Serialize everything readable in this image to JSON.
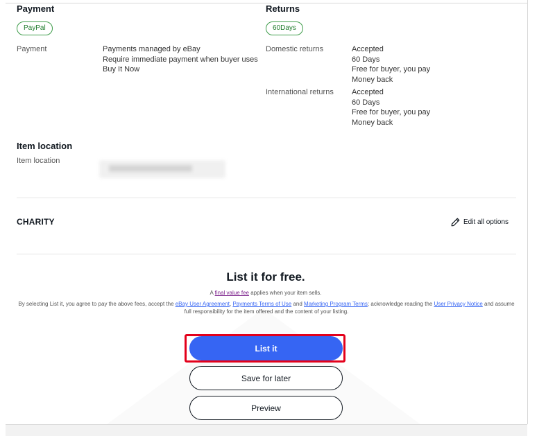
{
  "payment": {
    "heading": "Payment",
    "chip": "PayPal",
    "label": "Payment",
    "lines": [
      "Payments managed by eBay",
      "Require immediate payment when buyer uses",
      "Buy It Now"
    ]
  },
  "returns": {
    "heading": "Returns",
    "chip": "60Days",
    "domestic_label": "Domestic returns",
    "domestic_lines": [
      "Accepted",
      "60 Days",
      "Free for buyer, you pay",
      "Money back"
    ],
    "international_label": "International returns",
    "international_lines": [
      "Accepted",
      "60 Days",
      "Free for buyer, you pay",
      "Money back"
    ]
  },
  "item_location": {
    "heading": "Item location",
    "label": "Item location"
  },
  "charity": {
    "title": "CHARITY",
    "edit_label": "Edit all options",
    "edit_icon": "pencil-icon"
  },
  "listing": {
    "headline": "List it for free.",
    "fee_prefix": "A ",
    "fee_link": "final value fee",
    "fee_suffix": " applies when your item sells.",
    "legal_1": "By selecting List it, you agree to pay the above fees, accept the ",
    "legal_link_1": "eBay User Agreement",
    "legal_2": ", ",
    "legal_link_2": "Payments Terms of Use",
    "legal_3": " and ",
    "legal_link_3": "Marketing Program Terms",
    "legal_4": "; acknowledge reading the ",
    "legal_link_4": "User Privacy Notice",
    "legal_5": " and assume full responsibility for the item offered and the content of your listing."
  },
  "buttons": {
    "list_it": "List it",
    "save_for_later": "Save for later",
    "preview": "Preview"
  },
  "colors": {
    "primary": "#3665f3",
    "chip_green": "#3d9c49",
    "highlight_red": "#e3001b"
  }
}
